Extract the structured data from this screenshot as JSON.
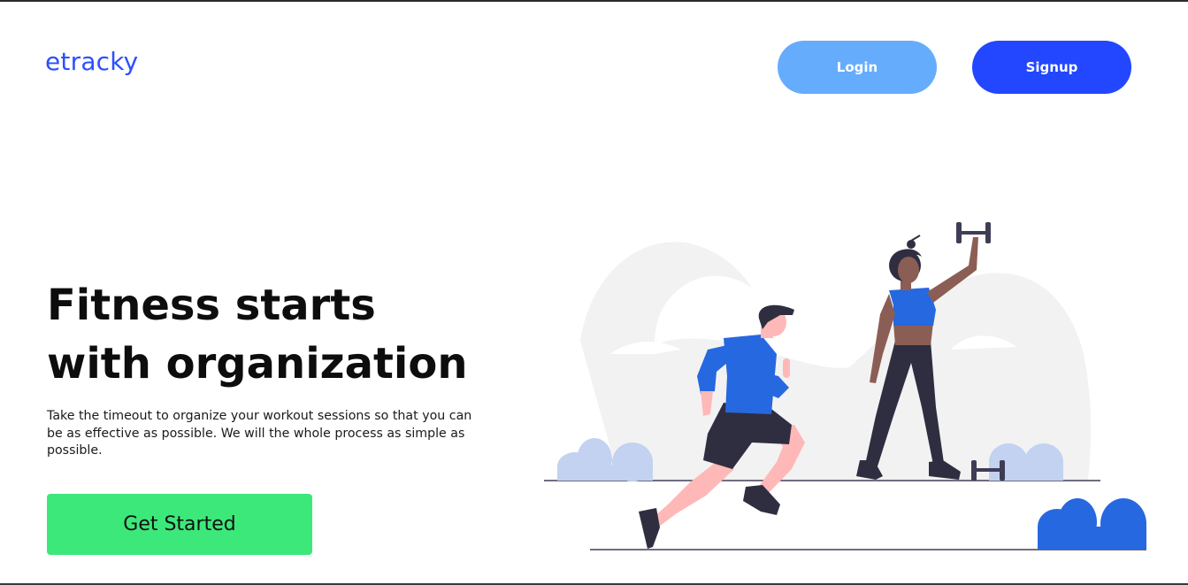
{
  "brand": {
    "logo": "etracky"
  },
  "nav": {
    "login_label": "Login",
    "signup_label": "Signup"
  },
  "hero": {
    "headline_line1": "Fitness starts",
    "headline_line2": "with organization",
    "description": "Take the timeout to organize your workout sessions so that you can be as effective as possible. We will the whole process as simple as possible.",
    "cta_label": "Get Started"
  },
  "illustration": {
    "icon": "fitness-illustration-icon"
  },
  "colors": {
    "brand": "#2b50ff",
    "login": "#66acfc",
    "signup": "#2247ff",
    "cta": "#3de87b",
    "accent_blue": "#2668e0",
    "bush_light": "#c2d2f0"
  }
}
